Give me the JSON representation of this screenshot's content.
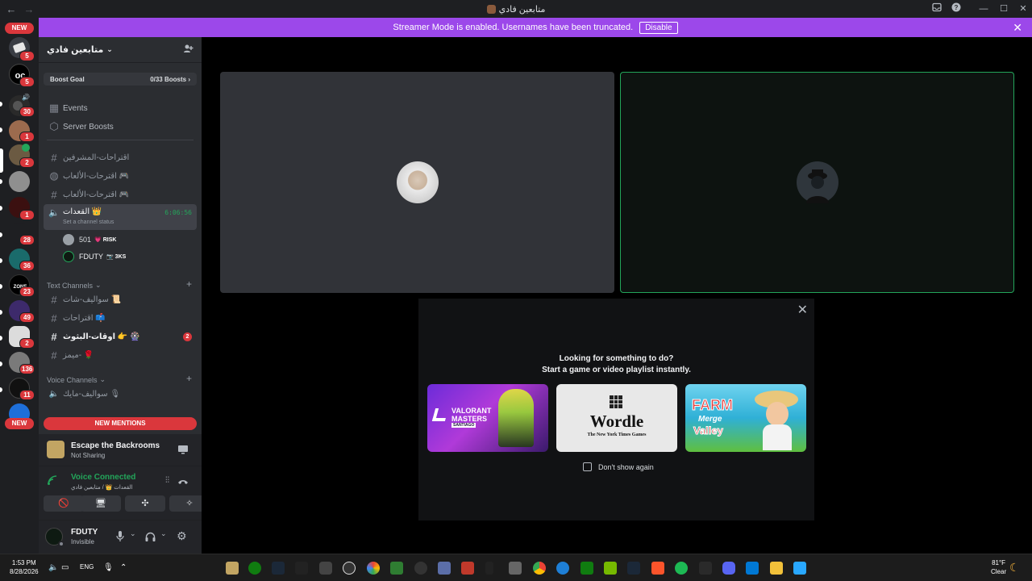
{
  "window": {
    "title": "متابعين فادي"
  },
  "banner": {
    "text": "Streamer Mode is enabled. Usernames have been truncated.",
    "disable_label": "Disable"
  },
  "rail": {
    "new_top": "NEW",
    "new_bottom": "NEW",
    "badges": [
      "5",
      "5",
      "30",
      "1",
      "2",
      "1",
      "28",
      "36",
      "23",
      "49",
      "2",
      "136",
      "11"
    ]
  },
  "guild": {
    "name": "متابعين فادي",
    "boost_goal_label": "Boost Goal",
    "boost_goal_value": "0/33 Boosts",
    "events": "Events",
    "server_boosts": "Server Boosts",
    "channels_top": [
      "اقتراحات-المشرفين",
      "اقترحات-الألعاب 🎮",
      "اقترحات-الألعاب 🎮"
    ],
    "voice_active": {
      "name": "القعدات 👑",
      "timer": "6:06:56",
      "status": "Set a channel status"
    },
    "voice_users": [
      {
        "name": "501",
        "tag": "RISK",
        "tag_color": "#f47fff"
      },
      {
        "name": "FDUTY",
        "tag": "3KS",
        "tag_color": "#dbdee1"
      }
    ],
    "text_category": "Text Channels",
    "text_channels": [
      {
        "name": "سواليف-شات 📜",
        "unread": ""
      },
      {
        "name": "اقتراحات 📫",
        "unread": ""
      },
      {
        "name": "اوقات-البثوث 👉 🎡",
        "unread": "2"
      },
      {
        "name": "ميمز- 🌹",
        "unread": ""
      }
    ],
    "voice_category": "Voice Channels",
    "voice_channels": [
      "سواليف-مايك 🎙"
    ],
    "new_mentions": "NEW MENTIONS"
  },
  "activity": {
    "title": "Escape the Backrooms",
    "subtitle": "Not Sharing"
  },
  "voice": {
    "status": "Voice Connected",
    "path": "القعدات 👑 / متابعين فادي"
  },
  "user": {
    "name": "FDUTY",
    "status": "Invisible"
  },
  "activities_panel": {
    "line1": "Looking for something to do?",
    "line2": "Start a game or video playlist instantly.",
    "cards": [
      {
        "title": "VALORANT",
        "sub": "MASTERS",
        "sub2": "SANTIAGO"
      },
      {
        "title": "Wordle",
        "sub": "The New York Times Games"
      },
      {
        "title": "FARM",
        "sub": "Merge",
        "sub2": "Valley"
      }
    ],
    "dont_show": "Don't show again"
  },
  "taskbar": {
    "time": "1:53 PM",
    "date": "8/28/2026",
    "lang": "ENG",
    "weather_temp": "81°F",
    "weather_desc": "Clear"
  },
  "colors": {
    "accent": "#9c48ea",
    "danger": "#da373c",
    "online": "#23a55a",
    "voice_green": "#23a55a"
  }
}
